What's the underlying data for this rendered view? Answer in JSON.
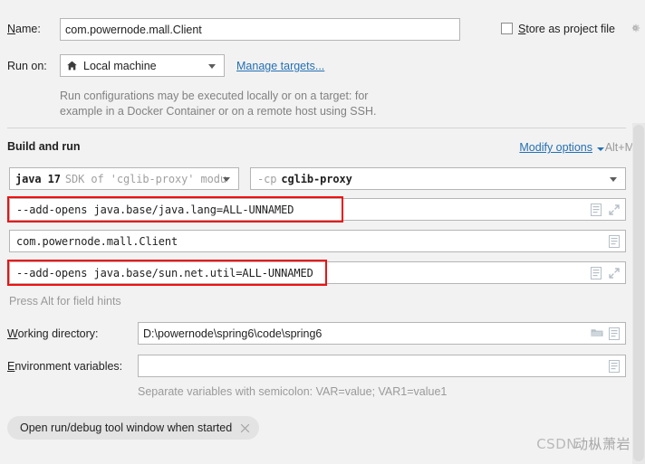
{
  "dialog": {
    "name_label": "Name:",
    "name_value": "com.powernode.mall.Client",
    "store_as_project_file_label": "Store as project file",
    "gear_icon": "gear-icon",
    "run_on_label": "Run on:",
    "run_on_value": "Local machine",
    "run_on_icon": "home-icon",
    "manage_targets_link": "Manage targets...",
    "targets_hint_line1": "Run configurations may be executed locally or on a target: for",
    "targets_hint_line2": "example in a Docker Container or on a remote host using SSH."
  },
  "build_and_run": {
    "section_title": "Build and run",
    "modify_options_label": "Modify options",
    "modify_options_shortcut": "Alt+M",
    "sdk": {
      "name": "java 17",
      "description": "SDK of 'cglib-proxy' modu"
    },
    "classpath": {
      "flag": "-cp",
      "module": "cglib-proxy"
    },
    "vm_options_value": "--add-opens java.base/java.lang=ALL-UNNAMED",
    "main_class_value": "com.powernode.mall.Client",
    "program_arguments_value": "--add-opens java.base/sun.net.util=ALL-UNNAMED",
    "field_hint": "Press Alt for field hints"
  },
  "paths": {
    "working_directory_label": "Working directory:",
    "working_directory_value": "D:\\powernode\\spring6\\code\\spring6",
    "environment_variables_label": "Environment variables:",
    "environment_variables_value": "",
    "environment_variables_hint": "Separate variables with semicolon: VAR=value; VAR1=value1"
  },
  "chips": [
    {
      "label": "Open run/debug tool window when started"
    }
  ],
  "watermark": {
    "prefix": "CSDN",
    "suffix": "动枞萧岩"
  },
  "colors": {
    "background": "#f2f2f2",
    "field_background": "#ffffff",
    "field_border": "#b5b5b5",
    "link": "#2470b3",
    "hint_text": "#9a9a9a",
    "highlight_red": "#ee1111",
    "chip_background": "#e3e3e3"
  }
}
